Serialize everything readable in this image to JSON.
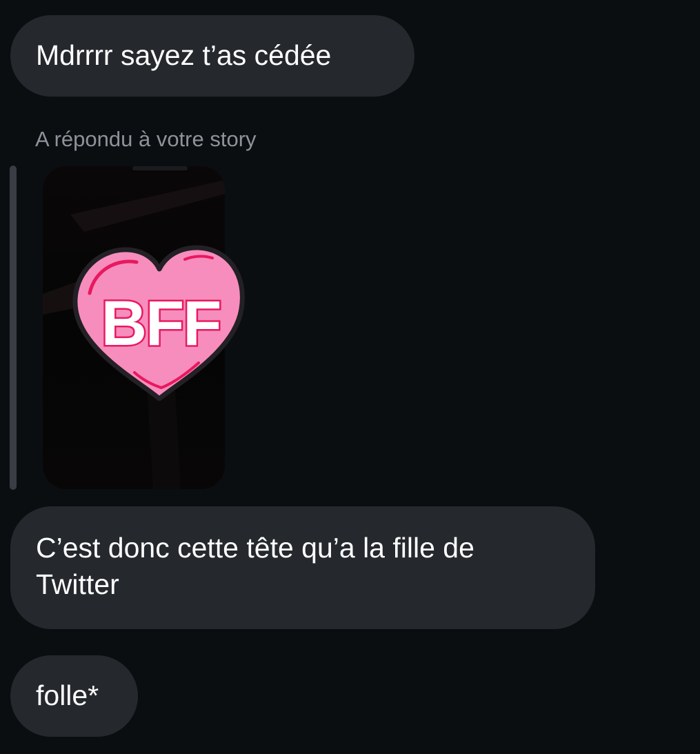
{
  "conversation": {
    "messages": [
      {
        "text": "Mdrrrr sayez t’as cédée"
      },
      {
        "lines": [
          "C’est donc cette tête qu’a la fille de",
          "Twitter"
        ]
      },
      {
        "text": "folle*"
      }
    ],
    "story_reply": {
      "caption": "A répondu à votre story",
      "sticker_text": "BFF",
      "sticker_colors": {
        "heart_fill": "#f78dbd",
        "heart_outline": "#232026",
        "accent": "#e8185f",
        "letter_fill": "#ffffff"
      }
    }
  },
  "theme": {
    "background": "#0b0e11",
    "bubble": "#25282d",
    "caption_color": "#8e939a",
    "text_color": "#ffffff"
  }
}
